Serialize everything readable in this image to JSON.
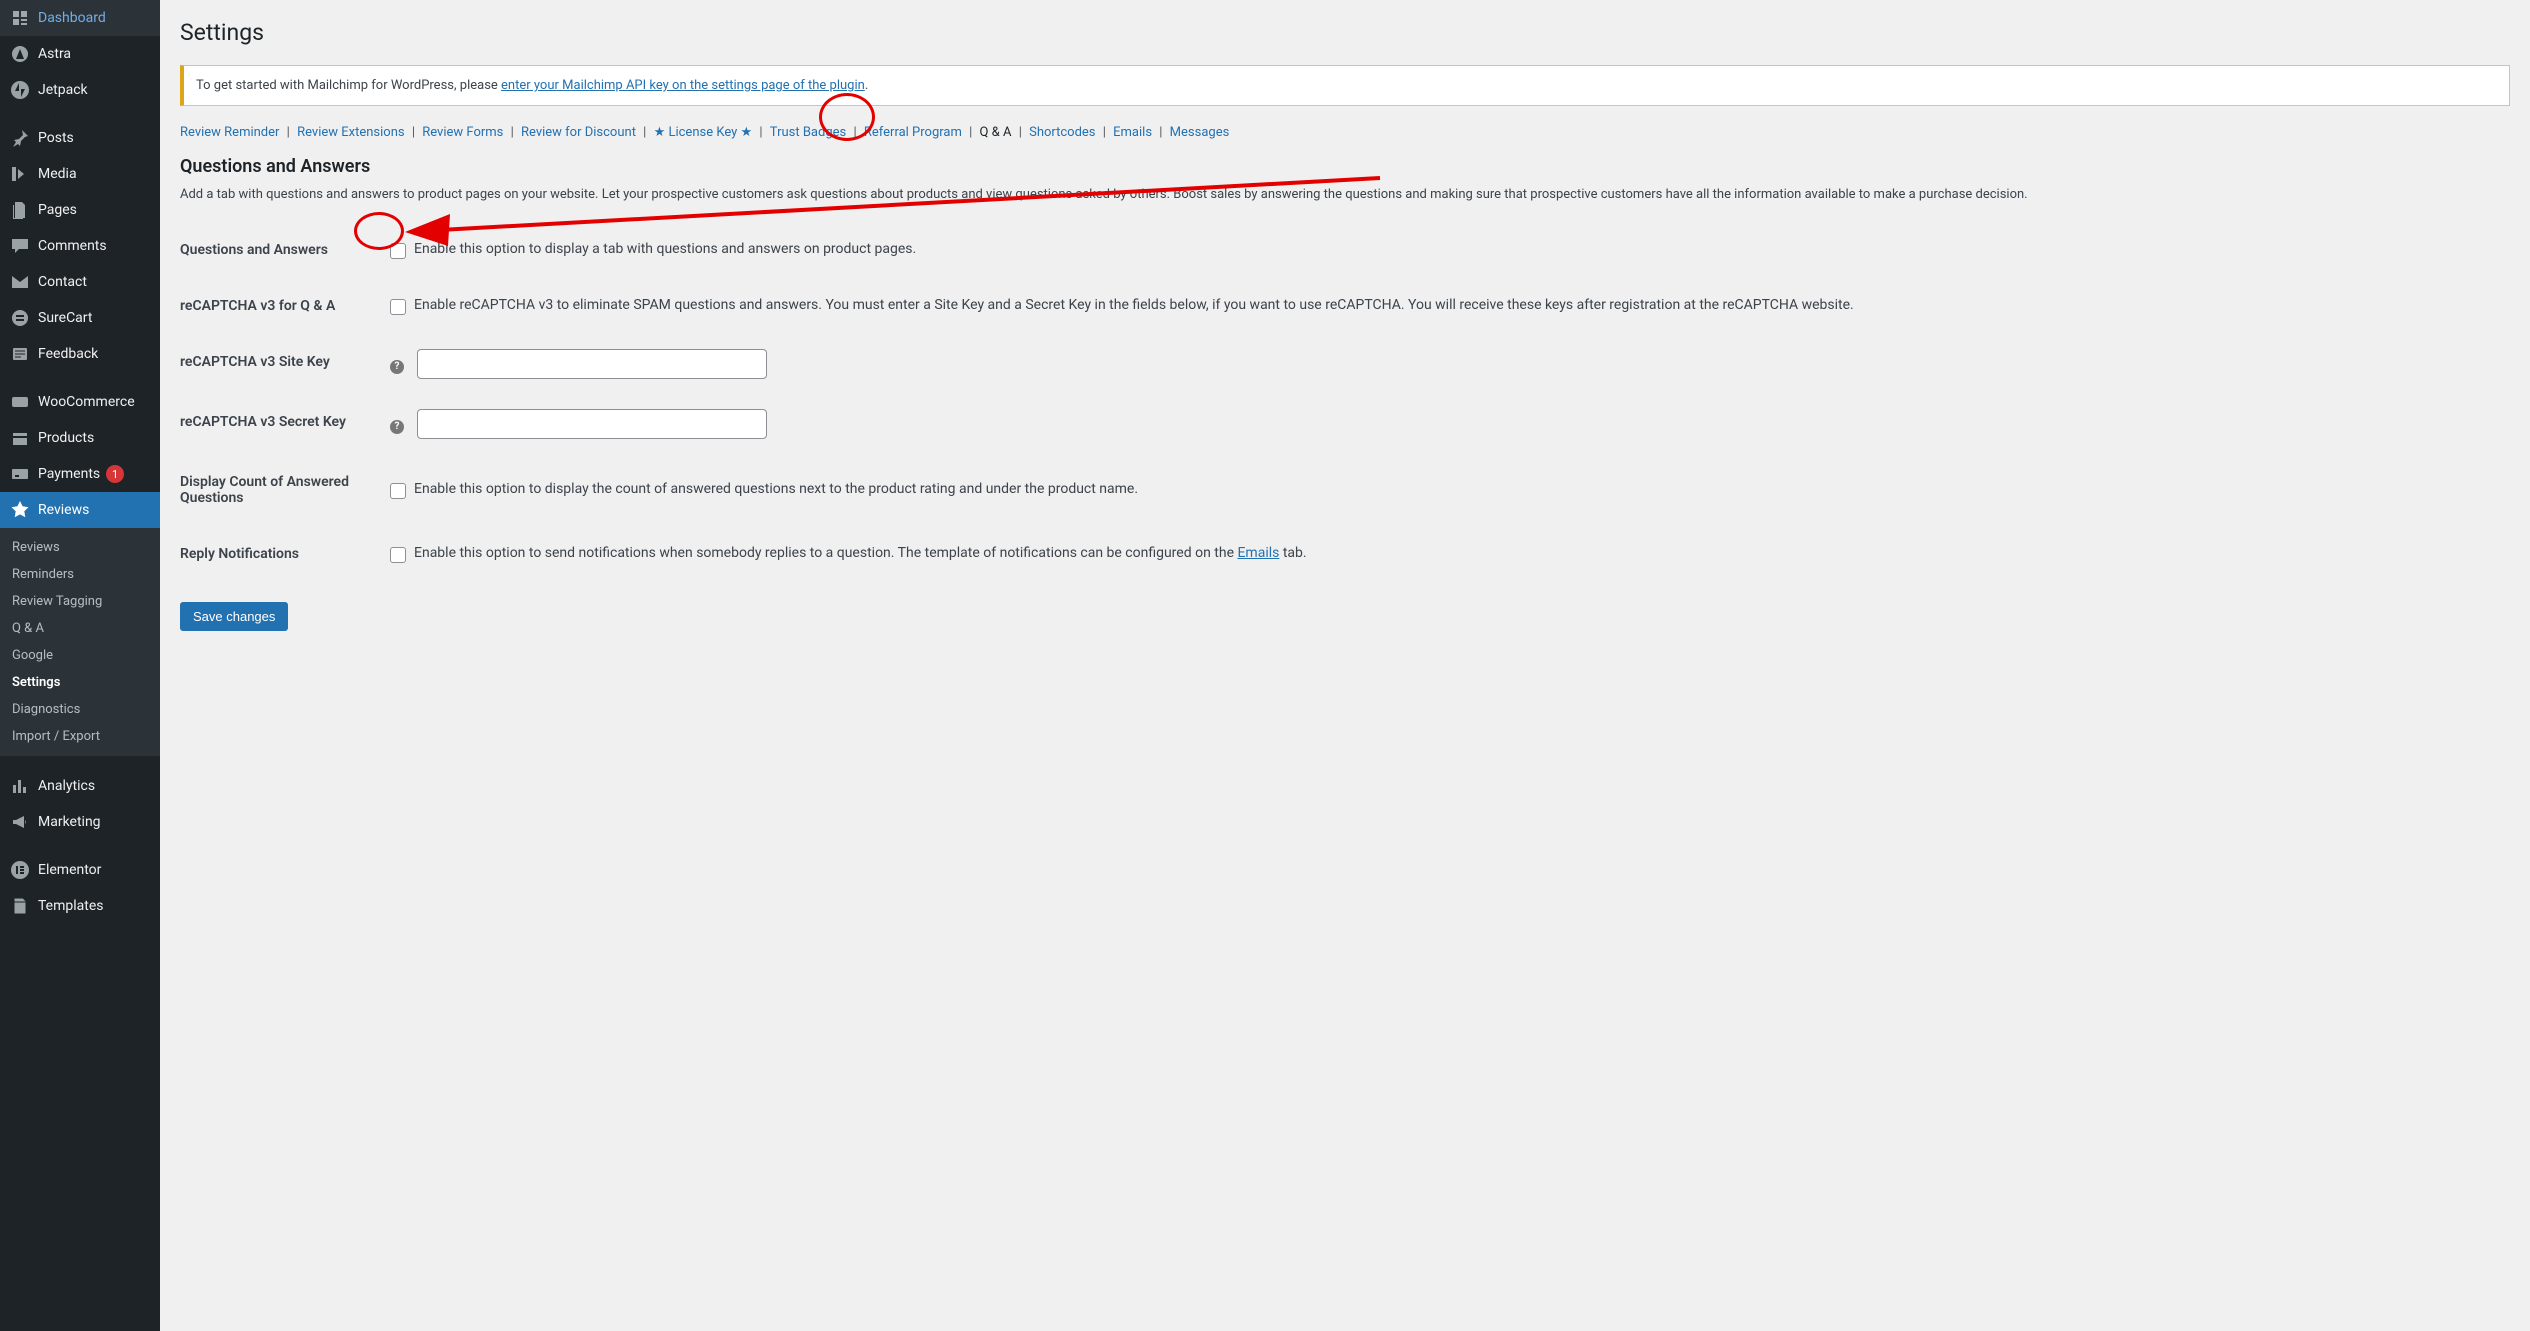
{
  "sidebar": {
    "items": [
      {
        "label": "Dashboard",
        "icon": "dashboard-icon"
      },
      {
        "label": "Astra",
        "icon": "astra-icon"
      },
      {
        "label": "Jetpack",
        "icon": "jetpack-icon"
      },
      {
        "label": "Posts",
        "icon": "pin-icon",
        "spacer": true
      },
      {
        "label": "Media",
        "icon": "media-icon"
      },
      {
        "label": "Pages",
        "icon": "pages-icon"
      },
      {
        "label": "Comments",
        "icon": "comments-icon"
      },
      {
        "label": "Contact",
        "icon": "mail-icon"
      },
      {
        "label": "SureCart",
        "icon": "surecart-icon"
      },
      {
        "label": "Feedback",
        "icon": "feedback-icon"
      },
      {
        "label": "WooCommerce",
        "icon": "woo-icon",
        "spacer": true
      },
      {
        "label": "Products",
        "icon": "products-icon"
      },
      {
        "label": "Payments",
        "icon": "payments-icon",
        "badge": "1"
      },
      {
        "label": "Reviews",
        "icon": "star-icon",
        "active": true
      },
      {
        "label": "Analytics",
        "icon": "analytics-icon",
        "spacer": true
      },
      {
        "label": "Marketing",
        "icon": "megaphone-icon"
      },
      {
        "label": "Elementor",
        "icon": "elementor-icon",
        "spacer": true
      },
      {
        "label": "Templates",
        "icon": "templates-icon"
      }
    ],
    "submenu": [
      {
        "label": "Reviews"
      },
      {
        "label": "Reminders"
      },
      {
        "label": "Review Tagging"
      },
      {
        "label": "Q & A"
      },
      {
        "label": "Google"
      },
      {
        "label": "Settings",
        "current": true
      },
      {
        "label": "Diagnostics"
      },
      {
        "label": "Import / Export"
      }
    ]
  },
  "page": {
    "title": "Settings",
    "notice_prefix": "To get started with Mailchimp for WordPress, please ",
    "notice_link": "enter your Mailchimp API key on the settings page of the plugin",
    "notice_suffix": ".",
    "tabs": [
      "Review Reminder",
      "Review Extensions",
      "Review Forms",
      "Review for Discount",
      "★ License Key ★",
      "Trust Badges",
      "Referral Program",
      "Q & A",
      "Shortcodes",
      "Emails",
      "Messages"
    ],
    "tabs_current": "Q & A",
    "section_title": "Questions and Answers",
    "section_desc": "Add a tab with questions and answers to product pages on your website. Let your prospective customers ask questions about products and view questions asked by others. Boost sales by answering the questions and making sure that prospective customers have all the information available to make a purchase decision.",
    "rows": {
      "qa_label": "Questions and Answers",
      "qa_text": "Enable this option to display a tab with questions and answers on product pages.",
      "recaptcha_qa_label": "reCAPTCHA v3 for Q & A",
      "recaptcha_qa_text": "Enable reCAPTCHA v3 to eliminate SPAM questions and answers. You must enter a Site Key and a Secret Key in the fields below, if you want to use reCAPTCHA. You will receive these keys after registration at the reCAPTCHA website.",
      "site_key_label": "reCAPTCHA v3 Site Key",
      "secret_key_label": "reCAPTCHA v3 Secret Key",
      "count_label": "Display Count of Answered Questions",
      "count_text": "Enable this option to display the count of answered questions next to the product rating and under the product name.",
      "reply_label": "Reply Notifications",
      "reply_text_prefix": "Enable this option to send notifications when somebody replies to a question. The template of notifications can be configured on the ",
      "reply_link": "Emails",
      "reply_text_suffix": " tab."
    },
    "save_button": "Save changes"
  }
}
